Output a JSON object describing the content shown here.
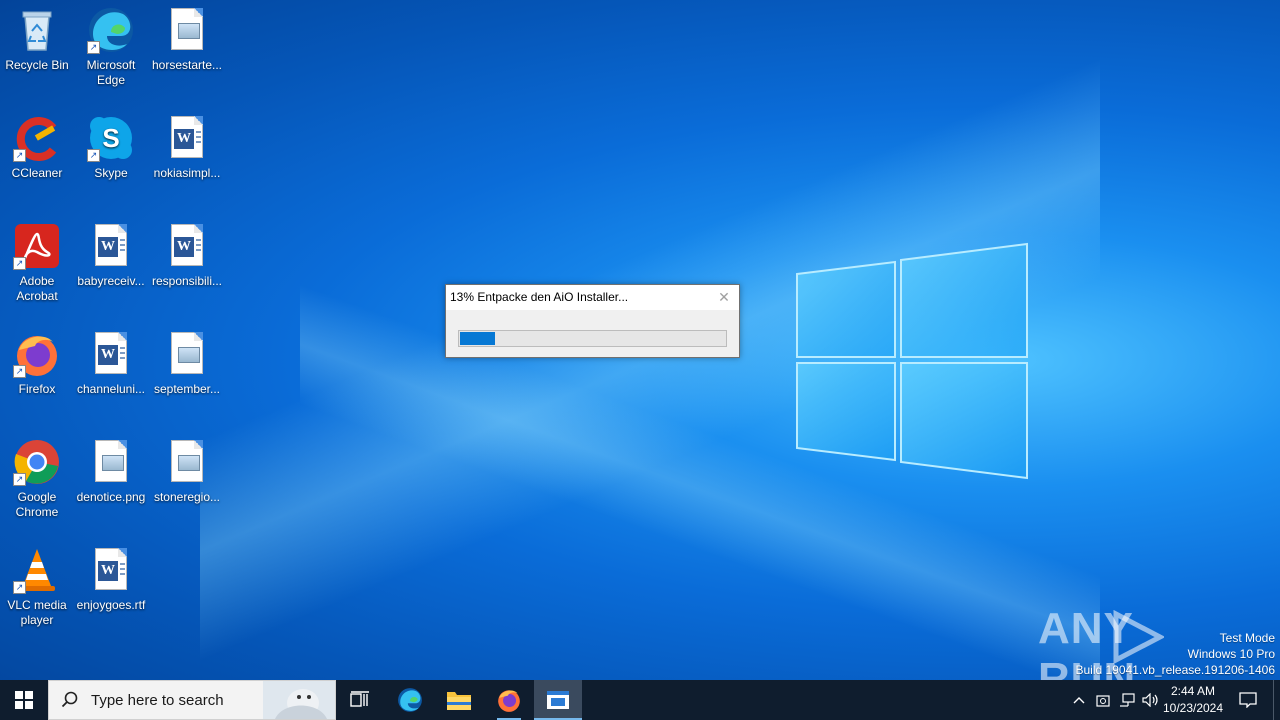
{
  "desktop": {
    "icons": [
      {
        "label": "Recycle Bin"
      },
      {
        "label": "Microsoft Edge"
      },
      {
        "label": "horsestarte..."
      },
      {
        "label": "CCleaner"
      },
      {
        "label": "Skype"
      },
      {
        "label": "nokiasimpl..."
      },
      {
        "label": "Adobe Acrobat"
      },
      {
        "label": "babyreceiv..."
      },
      {
        "label": "responsibili..."
      },
      {
        "label": "Firefox"
      },
      {
        "label": "channeluni..."
      },
      {
        "label": "september..."
      },
      {
        "label": "Google Chrome"
      },
      {
        "label": "denotice.png"
      },
      {
        "label": "stoneregio..."
      },
      {
        "label": "VLC media player"
      },
      {
        "label": "enjoygoes.rtf"
      }
    ]
  },
  "dialog": {
    "title": "13% Entpacke den AiO Installer...",
    "close_icon": "close-icon",
    "progress": 0.13
  },
  "watermark": {
    "brand": "ANY RUN",
    "test_mode": "Test Mode",
    "os": "Windows 10 Pro",
    "build": "Build 19041.vb_release.191206-1406"
  },
  "taskbar": {
    "search_placeholder": "Type here to search",
    "time": "2:44 AM",
    "date": "10/23/2024"
  },
  "colors": {
    "accent": "#0678d4",
    "taskbar": "#0f1d2e"
  }
}
